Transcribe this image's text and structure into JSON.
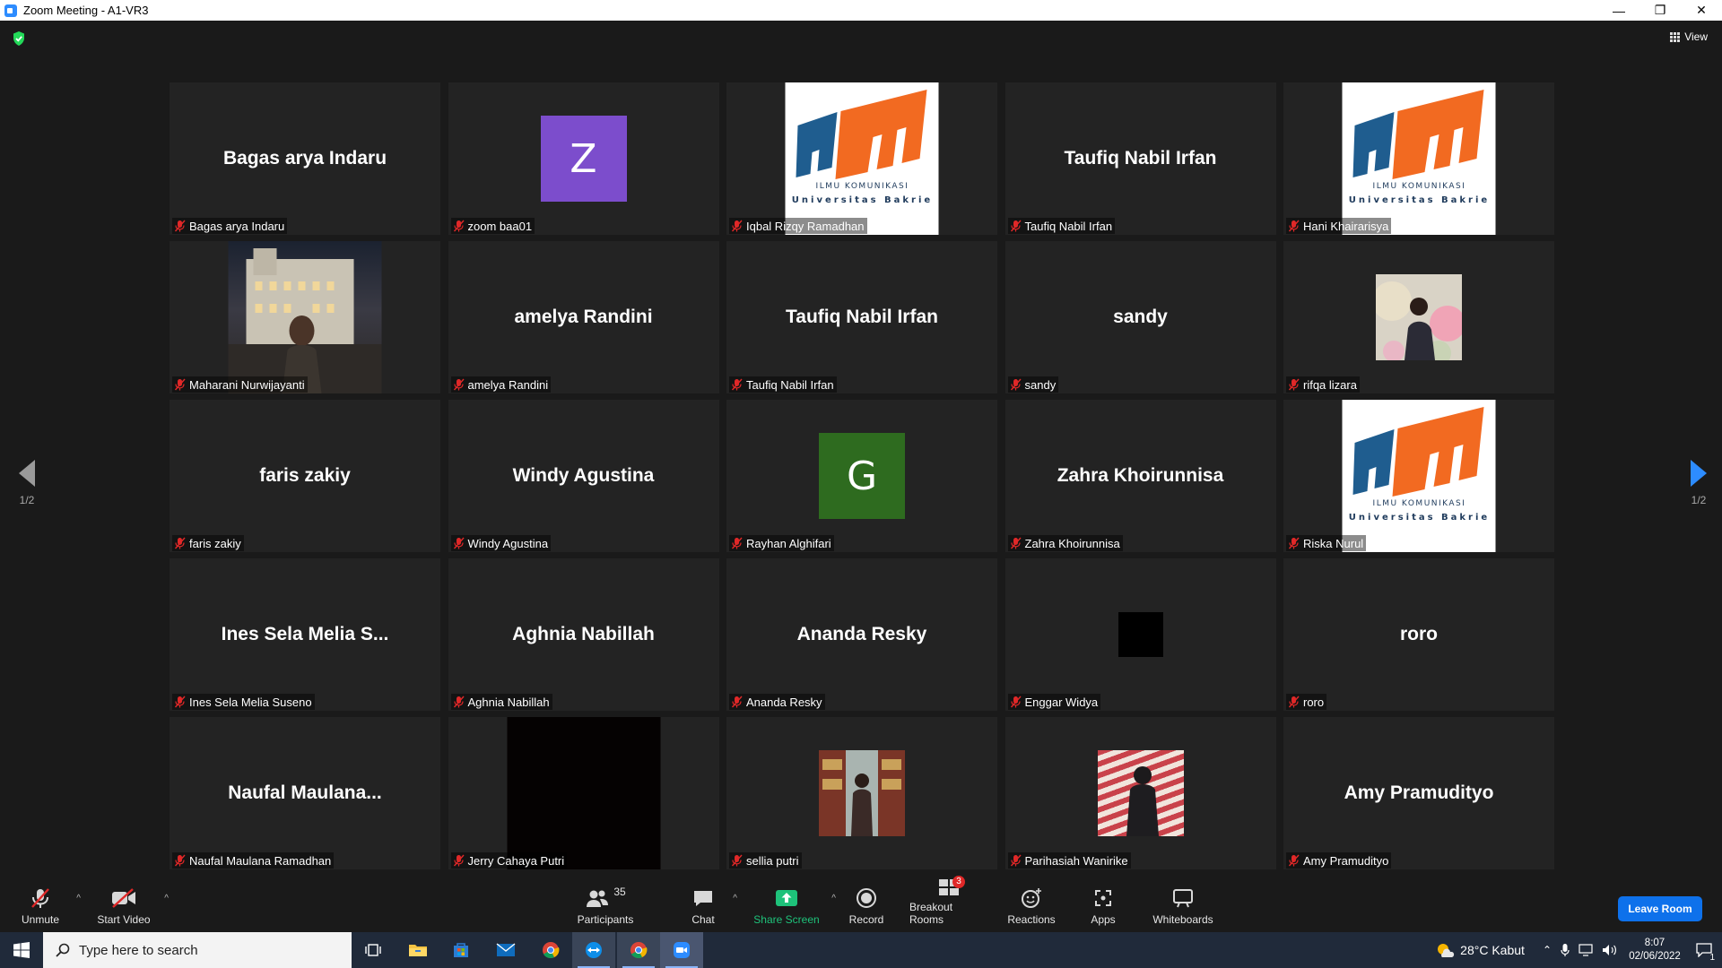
{
  "window": {
    "title": "Zoom Meeting - A1-VR3"
  },
  "header": {
    "view_label": "View"
  },
  "pager": {
    "left": "1/2",
    "right": "1/2"
  },
  "tiles": [
    {
      "kind": "name",
      "center": "Bagas arya Indaru",
      "label": "Bagas arya Indaru"
    },
    {
      "kind": "avatar",
      "letter": "Z",
      "color": "#7c4dcc",
      "label": "zoom baa01"
    },
    {
      "kind": "logo",
      "label": "Iqbal Rizqy Ramadhan"
    },
    {
      "kind": "name",
      "center": "Taufiq Nabil Irfan",
      "label": "Taufiq Nabil Irfan"
    },
    {
      "kind": "logo",
      "label": "Hani Khairarisya"
    },
    {
      "kind": "photo",
      "photo": "city",
      "label": "Maharani Nurwijayanti"
    },
    {
      "kind": "name",
      "center": "amelya Randini",
      "label": "amelya Randini"
    },
    {
      "kind": "name",
      "center": "Taufiq Nabil Irfan",
      "label": "Taufiq Nabil Irfan"
    },
    {
      "kind": "name",
      "center": "sandy",
      "label": "sandy"
    },
    {
      "kind": "photo",
      "photo": "balloons",
      "label": "rifqa lizara"
    },
    {
      "kind": "name",
      "center": "faris zakiy",
      "label": "faris zakiy"
    },
    {
      "kind": "name",
      "center": "Windy Agustina",
      "label": "Windy Agustina"
    },
    {
      "kind": "avatar",
      "letter": "G",
      "color": "#2e6b1f",
      "label": "Rayhan Alghifari"
    },
    {
      "kind": "name",
      "center": "Zahra Khoirunnisa",
      "label": "Zahra Khoirunnisa"
    },
    {
      "kind": "logo",
      "label": "Riska Nurul"
    },
    {
      "kind": "name",
      "center": "Ines Sela Melia S...",
      "label": "Ines Sela Melia Suseno"
    },
    {
      "kind": "name",
      "center": "Aghnia Nabillah",
      "label": "Aghnia Nabillah"
    },
    {
      "kind": "name",
      "center": "Ananda Resky",
      "label": "Ananda Resky"
    },
    {
      "kind": "photo",
      "photo": "black",
      "label": "Enggar Widya"
    },
    {
      "kind": "name",
      "center": "roro",
      "label": "roro"
    },
    {
      "kind": "name",
      "center": "Naufal  Maulana...",
      "label": "Naufal Maulana Ramadhan"
    },
    {
      "kind": "photo",
      "photo": "dark",
      "label": "Jerry Cahaya Putri"
    },
    {
      "kind": "photo",
      "photo": "shop",
      "label": "sellia putri"
    },
    {
      "kind": "photo",
      "photo": "stripes",
      "label": "Parihasiah Wanirike"
    },
    {
      "kind": "name",
      "center": "Amy Pramudityo",
      "label": "Amy Pramudityo"
    }
  ],
  "logo_text": {
    "line1": "ILMU KOMUNIKASI",
    "line2": "Universitas Bakrie"
  },
  "toolbar": {
    "unmute": "Unmute",
    "start_video": "Start Video",
    "participants": "Participants",
    "participants_count": "35",
    "chat": "Chat",
    "share_screen": "Share Screen",
    "record": "Record",
    "breakout_rooms": "Breakout Rooms",
    "breakout_badge": "3",
    "reactions": "Reactions",
    "apps": "Apps",
    "whiteboards": "Whiteboards",
    "leave": "Leave Room",
    "caret": "^"
  },
  "taskbar": {
    "search_placeholder": "Type here to search",
    "weather": "28°C  Kabut",
    "time": "8:07",
    "date": "02/06/2022",
    "notifications": "1"
  },
  "colors": {
    "accent": "#2d8cff",
    "leave": "#0e71eb",
    "share": "#1ec27a",
    "muted": "#e02828"
  }
}
